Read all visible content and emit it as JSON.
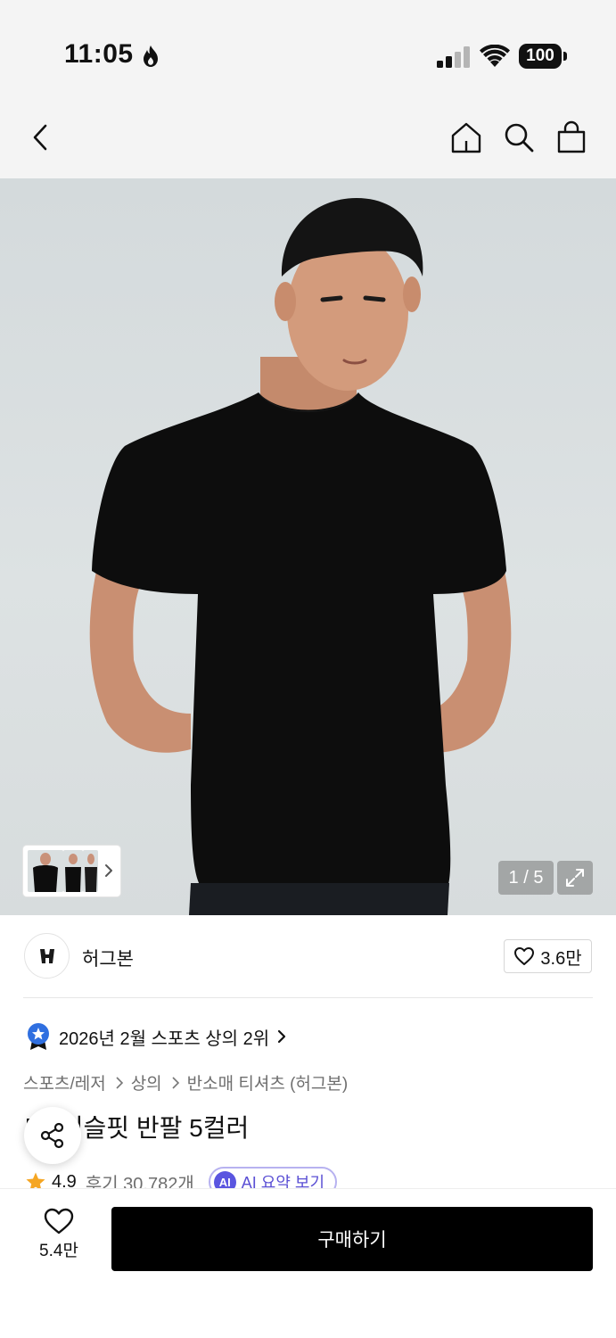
{
  "status_bar": {
    "time": "11:05",
    "battery": "100"
  },
  "nav": {
    "icons": [
      "back-icon",
      "home-icon",
      "search-icon",
      "shopping-bag-icon"
    ]
  },
  "gallery": {
    "page_counter": "1 / 5",
    "current": 1,
    "total": 5
  },
  "brand": {
    "name": "허그본",
    "likes": "3.6만"
  },
  "ranking": {
    "text": "2026년 2월 스포츠 상의 2위"
  },
  "breadcrumb": {
    "items": [
      "스포츠/레저",
      "상의",
      "반소매 티셔츠 (허그본)"
    ]
  },
  "product": {
    "title": "머슬핏 반팔 5컬러",
    "title_prefix": "["
  },
  "rating": {
    "score": "4.9",
    "reviews": "후기 30,782개",
    "ai_badge": "AI",
    "ai_summary": "AI 요약 보기"
  },
  "bottom_bar": {
    "wish_count": "5.4만",
    "buy_label": "구매하기"
  },
  "colors": {
    "accent": "#000000",
    "ai": "#5a4fd4",
    "star": "#f5a623",
    "ranking_badge": "#2f6fe0"
  }
}
